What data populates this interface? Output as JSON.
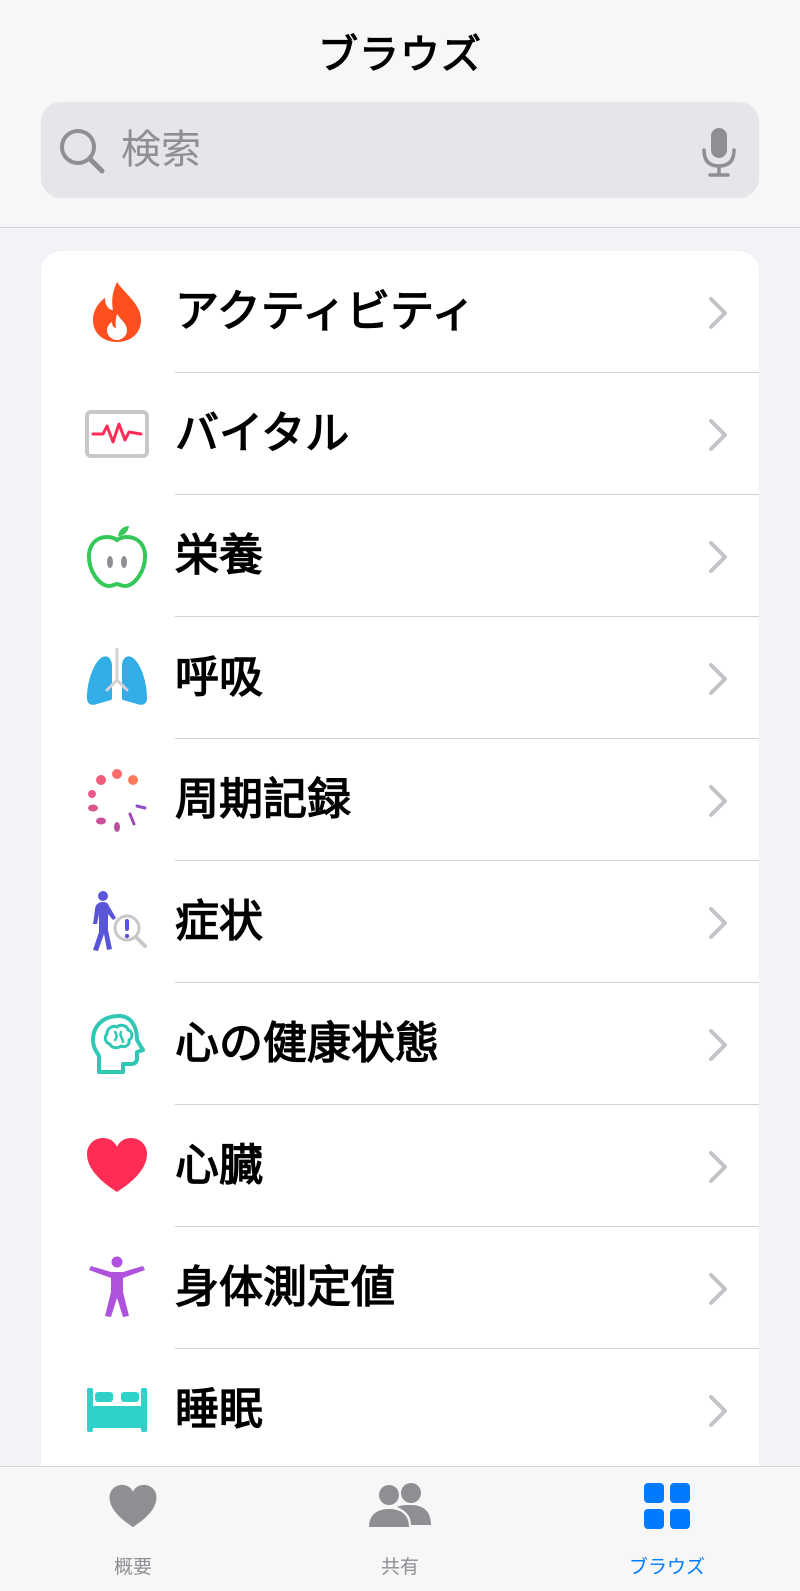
{
  "header": {
    "title": "ブラウズ"
  },
  "search": {
    "placeholder": "検索",
    "icon": "search-icon",
    "mic_icon": "microphone-icon"
  },
  "categories": [
    {
      "label": "アクティビティ",
      "icon": "flame-icon",
      "color": "#ff5722"
    },
    {
      "label": "バイタル",
      "icon": "vitals-monitor-icon",
      "color": "#ff2d55"
    },
    {
      "label": "栄養",
      "icon": "apple-icon",
      "color": "#34c759"
    },
    {
      "label": "呼吸",
      "icon": "lungs-icon",
      "color": "#32ade6"
    },
    {
      "label": "周期記録",
      "icon": "cycle-dots-icon",
      "color": "#ff6b6b"
    },
    {
      "label": "症状",
      "icon": "symptoms-person-icon",
      "color": "#5856d6"
    },
    {
      "label": "心の健康状態",
      "icon": "brain-head-icon",
      "color": "#30c7b5"
    },
    {
      "label": "心臓",
      "icon": "heart-icon",
      "color": "#ff2d55"
    },
    {
      "label": "身体測定値",
      "icon": "body-figure-icon",
      "color": "#af52de"
    },
    {
      "label": "睡眠",
      "icon": "bed-icon",
      "color": "#30d1c9"
    }
  ],
  "tabbar": {
    "tabs": [
      {
        "label": "概要",
        "icon": "heart-icon",
        "active": false
      },
      {
        "label": "共有",
        "icon": "people-icon",
        "active": false
      },
      {
        "label": "ブラウズ",
        "icon": "grid-icon",
        "active": true
      }
    ]
  },
  "colors": {
    "accent": "#007aff",
    "background": "#f2f2f7",
    "card": "#ffffff",
    "secondary_text": "#8e8e93"
  }
}
